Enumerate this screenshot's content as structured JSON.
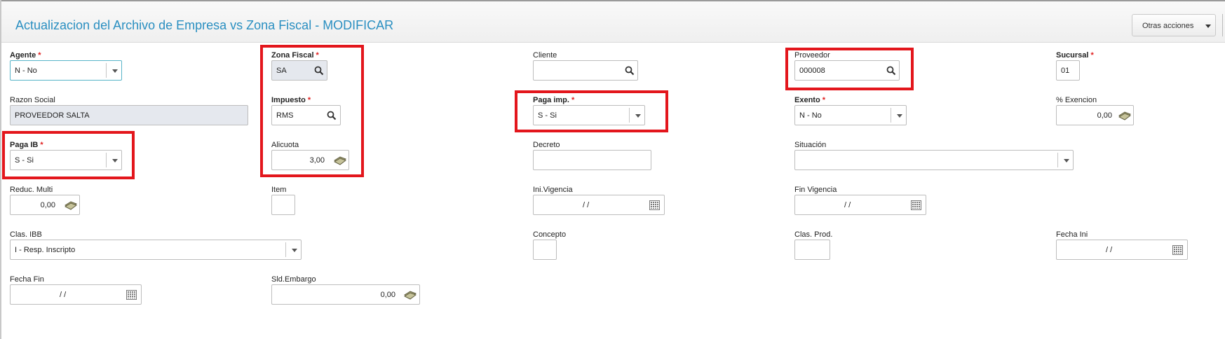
{
  "header": {
    "title": "Actualizacion del Archivo de Empresa vs Zona Fiscal - MODIFICAR",
    "otras_acciones": "Otras acciones"
  },
  "required_mark": "*",
  "fields": {
    "agente": {
      "label": "Agente",
      "value": "N - No"
    },
    "zona_fiscal": {
      "label": "Zona Fiscal",
      "value": "SA"
    },
    "cliente": {
      "label": "Cliente",
      "value": ""
    },
    "proveedor": {
      "label": "Proveedor",
      "value": "000008"
    },
    "sucursal": {
      "label": "Sucursal",
      "value": "01"
    },
    "razon_social": {
      "label": "Razon Social",
      "value": "PROVEEDOR SALTA"
    },
    "impuesto": {
      "label": "Impuesto",
      "value": "RMS"
    },
    "paga_imp": {
      "label": "Paga imp.",
      "value": "S - Si"
    },
    "exento": {
      "label": "Exento",
      "value": "N - No"
    },
    "pct_exencion": {
      "label": "% Exencion",
      "value": "0,00"
    },
    "paga_ib": {
      "label": "Paga IB",
      "value": "S - Si"
    },
    "alicuota": {
      "label": "Alicuota",
      "value": "3,00"
    },
    "decreto": {
      "label": "Decreto",
      "value": ""
    },
    "situacion": {
      "label": "Situación",
      "value": ""
    },
    "reduc_multi": {
      "label": "Reduc. Multi",
      "value": "0,00"
    },
    "item": {
      "label": "Item",
      "value": ""
    },
    "ini_vigencia": {
      "label": "Ini.Vigencia",
      "value": "/ /"
    },
    "fin_vigencia": {
      "label": "Fin Vigencia",
      "value": "/ /"
    },
    "clas_ibb": {
      "label": "Clas. IBB",
      "value": "I - Resp. Inscripto"
    },
    "concepto": {
      "label": "Concepto",
      "value": ""
    },
    "clas_prod": {
      "label": "Clas. Prod.",
      "value": ""
    },
    "fecha_ini": {
      "label": "Fecha Ini",
      "value": "/ /"
    },
    "fecha_fin": {
      "label": "Fecha Fin",
      "value": "/ /"
    },
    "sld_embargo": {
      "label": "Sld.Embargo",
      "value": "0,00"
    }
  },
  "icons": {
    "search": "magnifier-icon",
    "money": "money-icon",
    "calendar": "calendar-icon",
    "dropdown": "chevron-down-icon"
  },
  "colors": {
    "title": "#2a8fc1",
    "required": "#e02020",
    "highlight": "#e3161c",
    "readonly_bg": "#e5e8ee"
  }
}
